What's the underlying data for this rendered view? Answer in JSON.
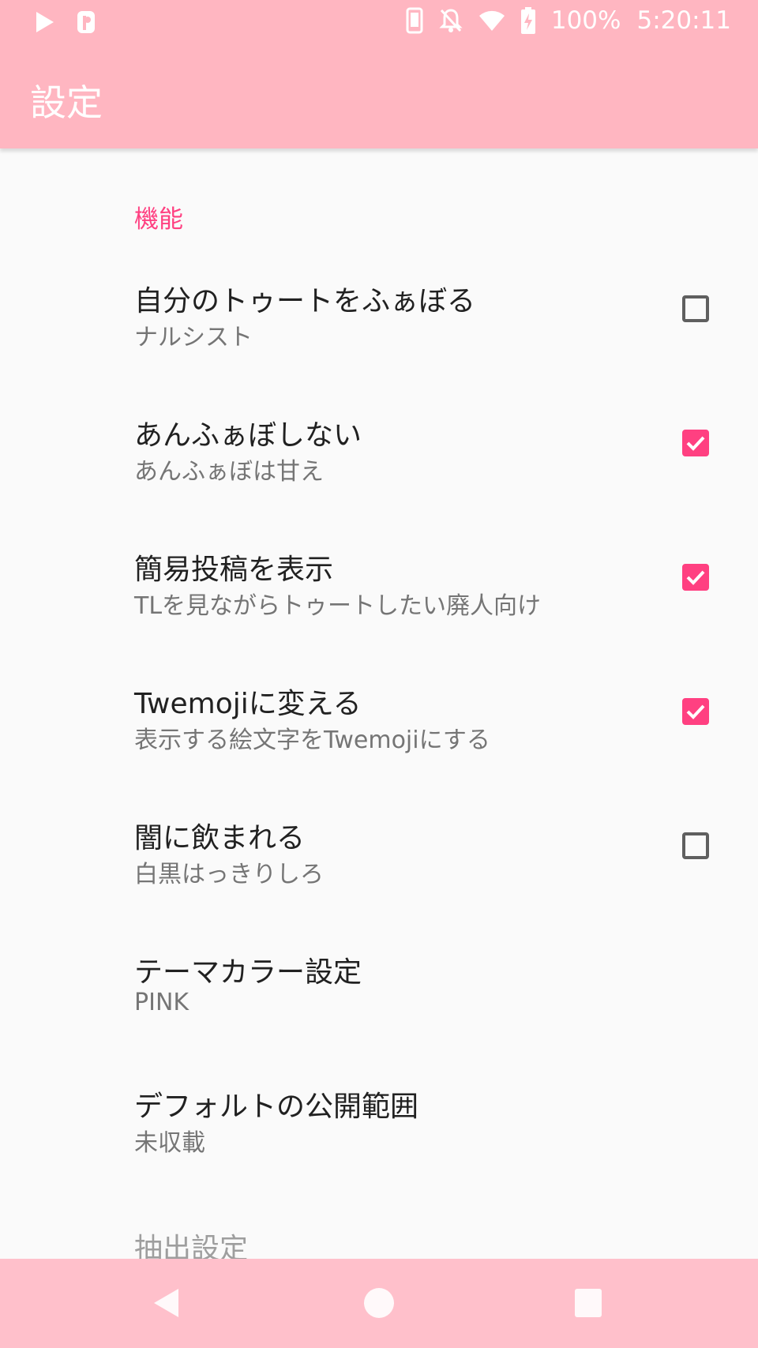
{
  "status_bar": {
    "left_icons": [
      "play-store-icon",
      "p-app-icon"
    ],
    "right_icons": [
      "phone-vibrate-icon",
      "notifications-off-icon",
      "wifi-icon",
      "battery-charging-icon"
    ],
    "battery": "100%",
    "time": "5:20:11"
  },
  "app_bar": {
    "title": "設定"
  },
  "category": {
    "label": "機能"
  },
  "preferences": [
    {
      "title": "自分のトゥートをふぁぼる",
      "summary": "ナルシスト",
      "checked": false
    },
    {
      "title": "あんふぁぼしない",
      "summary": "あんふぁぼは甘え",
      "checked": true
    },
    {
      "title": "簡易投稿を表示",
      "summary": "TLを見ながらトゥートしたい廃人向け",
      "checked": true
    },
    {
      "title": "Twemojiに変える",
      "summary": "表示する絵文字をTwemojiにする",
      "checked": true
    },
    {
      "title": "闇に飲まれる",
      "summary": "白黒はっきりしろ",
      "checked": false
    },
    {
      "title": "テーマカラー設定",
      "summary": "PINK"
    },
    {
      "title": "デフォルトの公開範囲",
      "summary": "未収載"
    }
  ],
  "cut_off_item": {
    "title": "抽出設定"
  },
  "nav_bar": {
    "buttons": [
      "back-icon",
      "home-icon",
      "recents-icon"
    ]
  },
  "colors": {
    "bar": "#ffb6c1",
    "nav_bar": "#ffc0cb",
    "accent": "#ff4081",
    "checkbox_unchecked": "#5f5f5f"
  }
}
